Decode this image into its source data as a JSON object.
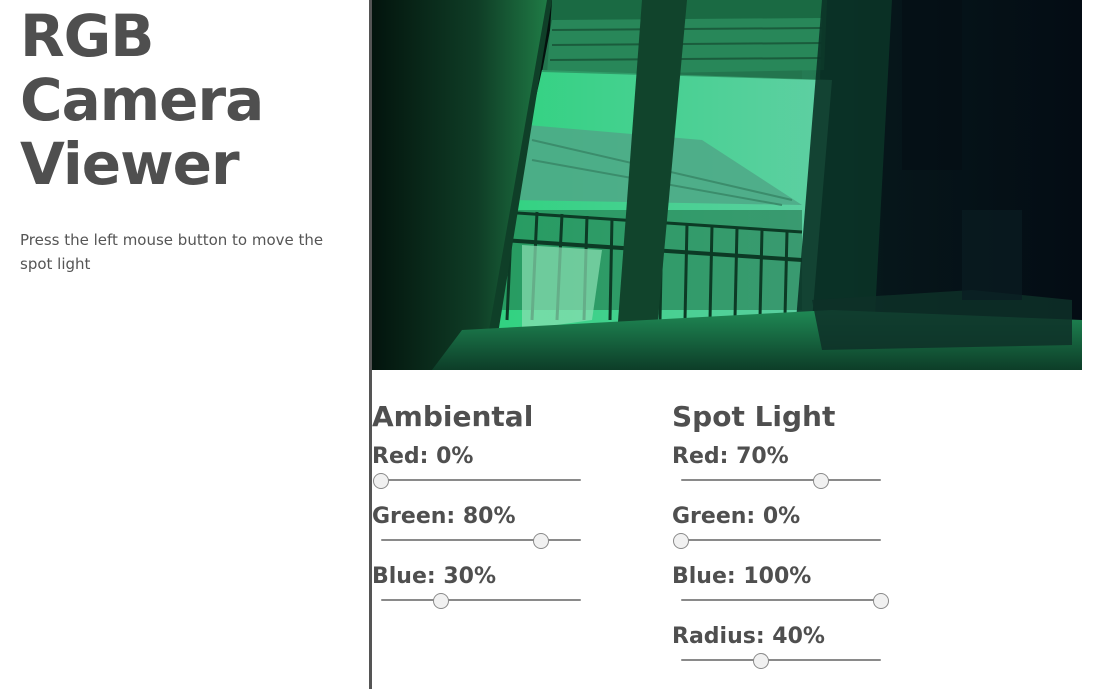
{
  "app": {
    "title_lines": [
      "RGB",
      "Camera",
      "Viewer"
    ],
    "hint": "Press the left mouse button to move the spot light"
  },
  "viewer": {
    "tint_color": "#29d37c"
  },
  "ambient": {
    "heading": "Ambiental",
    "controls": [
      {
        "label": "Red: 0%",
        "value": 0
      },
      {
        "label": "Green: 80%",
        "value": 80
      },
      {
        "label": "Blue: 30%",
        "value": 30
      }
    ]
  },
  "spot": {
    "heading": "Spot Light",
    "controls": [
      {
        "label": "Red: 70%",
        "value": 70
      },
      {
        "label": "Green: 0%",
        "value": 0
      },
      {
        "label": "Blue: 100%",
        "value": 100
      },
      {
        "label": "Radius: 40%",
        "value": 40
      }
    ]
  }
}
